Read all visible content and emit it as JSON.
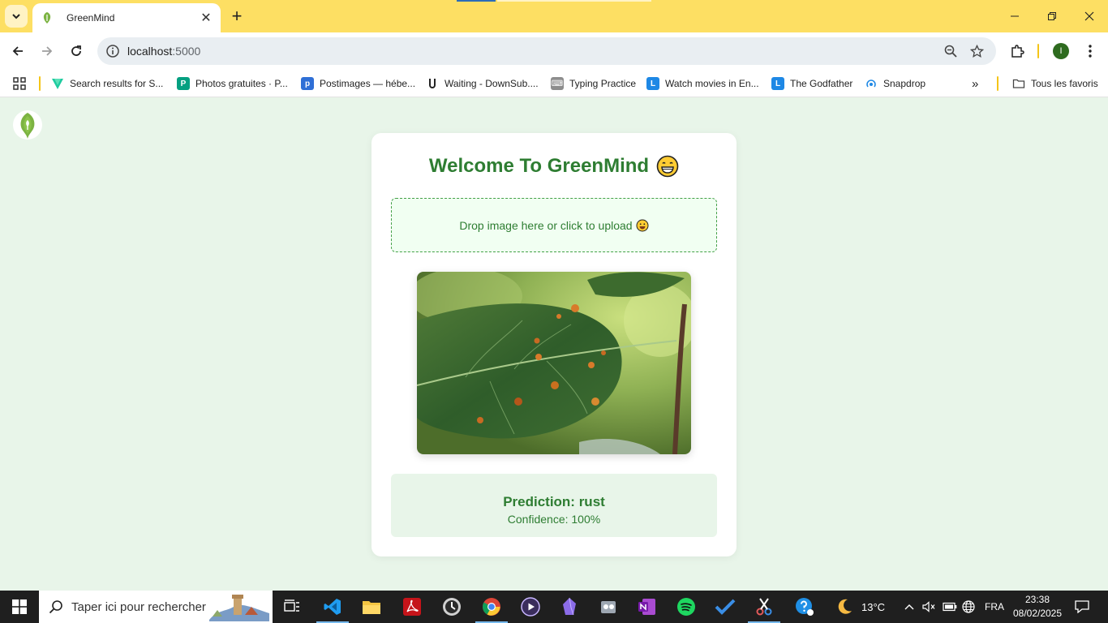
{
  "browser": {
    "tab_title": "GreenMind",
    "url_host": "localhost",
    "url_port": ":5000",
    "profile_initial": "I",
    "colors": {
      "titlebar": "#fddf63",
      "omnibox": "#e9eef2"
    }
  },
  "bookmarks": {
    "items": [
      {
        "label": "Search results for S...",
        "icon": "vuetify-icon"
      },
      {
        "label": "Photos gratuites · P...",
        "icon": "pexels-icon"
      },
      {
        "label": "Postimages — hébe...",
        "icon": "postimages-icon"
      },
      {
        "label": "Waiting - DownSub....",
        "icon": "downsub-icon"
      },
      {
        "label": "Typing Practice",
        "icon": "typing-icon"
      },
      {
        "label": "Watch movies in En...",
        "icon": "lookmovie-icon"
      },
      {
        "label": "The Godfather",
        "icon": "lookmovie-icon"
      },
      {
        "label": "Snapdrop",
        "icon": "snapdrop-icon"
      }
    ],
    "all_bookmarks_label": "Tous les favoris"
  },
  "page": {
    "title": "Welcome To GreenMind",
    "dropzone_text": "Drop image here or click to upload",
    "prediction_text": "Prediction: rust",
    "confidence_text": "Confidence: 100%",
    "colors": {
      "background": "#e8f5e9",
      "accent": "#2e7d32",
      "card": "#ffffff"
    }
  },
  "taskbar": {
    "search_placeholder": "Taper ici pour rechercher",
    "weather_temp": "13°C",
    "language": "FRA",
    "time": "23:38",
    "date": "08/02/2025"
  }
}
